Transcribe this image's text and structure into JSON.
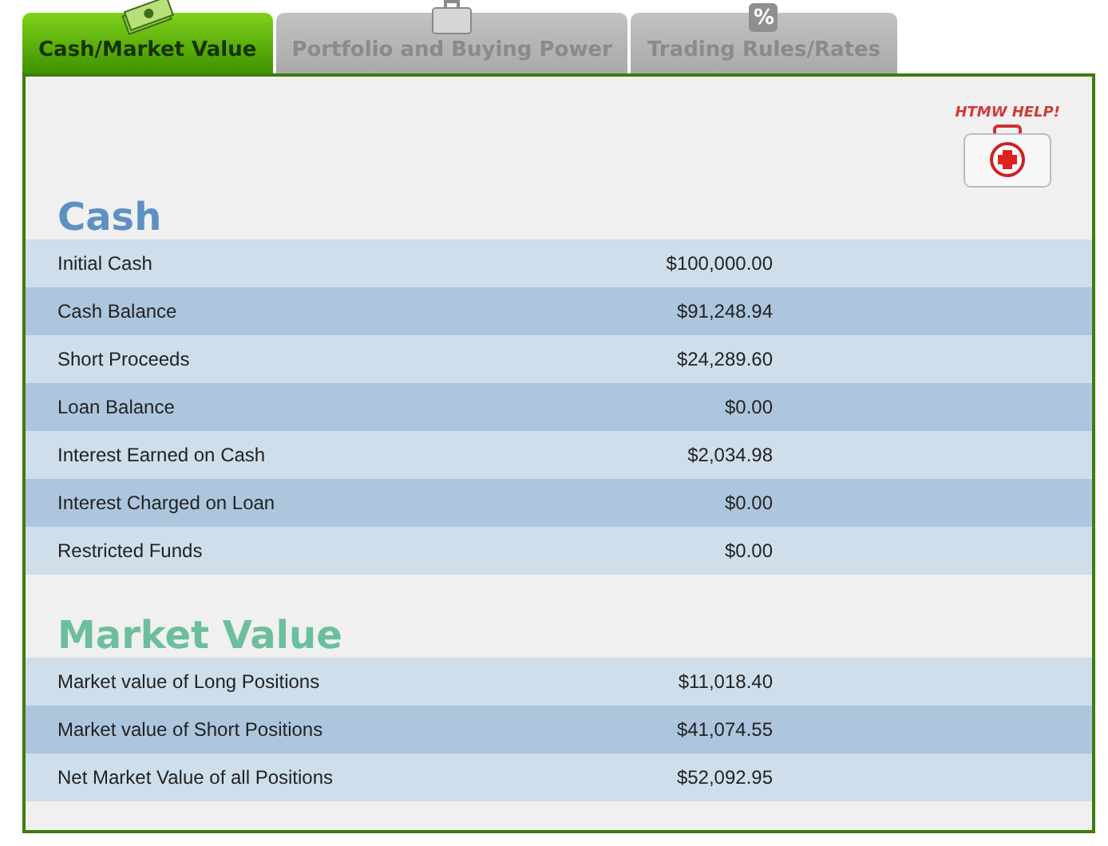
{
  "tabs": [
    {
      "label": "Cash/Market Value",
      "selected": true
    },
    {
      "label": "Portfolio and Buying Power",
      "selected": false
    },
    {
      "label": "Trading Rules/Rates",
      "selected": false,
      "glyph": "%"
    }
  ],
  "help": {
    "label": "HTMW HELP!"
  },
  "sections": [
    {
      "title": "Cash",
      "color": "#5e90c4",
      "rows": [
        {
          "label": "Initial Cash",
          "value": "$100,000.00"
        },
        {
          "label": "Cash Balance",
          "value": "$91,248.94"
        },
        {
          "label": "Short Proceeds",
          "value": "$24,289.60"
        },
        {
          "label": "Loan Balance",
          "value": "$0.00"
        },
        {
          "label": "Interest Earned on Cash",
          "value": "$2,034.98"
        },
        {
          "label": "Interest Charged on Loan",
          "value": "$0.00"
        },
        {
          "label": "Restricted Funds",
          "value": "$0.00"
        }
      ]
    },
    {
      "title": "Market Value",
      "color": "#6cbf9c",
      "rows": [
        {
          "label": "Market value of Long Positions",
          "value": "$11,018.40"
        },
        {
          "label": "Market value of Short Positions",
          "value": "$41,074.55"
        },
        {
          "label": "Net Market Value of all Positions",
          "value": "$52,092.95"
        }
      ]
    }
  ]
}
